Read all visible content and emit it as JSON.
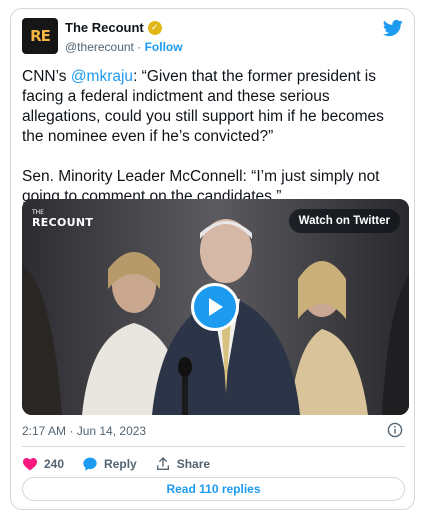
{
  "account": {
    "avatar_text": "RE",
    "display_name": "The Recount",
    "handle": "@therecount",
    "separator": "·",
    "follow_label": "Follow"
  },
  "tweet": {
    "text_before_mention": "CNN’s ",
    "mention": "@mkraju",
    "text_after_mention": ": “Given that the former president is facing a federal indictment and these serious allegations, could you still support him if he becomes the nominee even if he’s convicted?”\n\nSen. Minority Leader McConnell: “I’m just simply not going to comment on the candidates.”",
    "timestamp": "2:17 AM · Jun 14, 2023"
  },
  "media": {
    "brand_text": "RECOUNT",
    "brand_prefix": "THE",
    "watch_label": "Watch on Twitter"
  },
  "actions": {
    "like_count": "240",
    "reply_label": "Reply",
    "share_label": "Share",
    "read_replies_label": "Read 110 replies"
  },
  "colors": {
    "accent": "#1d9bf0",
    "like": "#f91880",
    "verified": "#e2b719",
    "secondary_text": "#536471"
  },
  "icons": {
    "bird": "twitter-bird-icon",
    "verified": "verified-badge-icon",
    "play": "play-icon",
    "info": "info-icon",
    "like": "heart-icon",
    "reply": "reply-bubble-icon",
    "share": "share-upload-icon"
  }
}
